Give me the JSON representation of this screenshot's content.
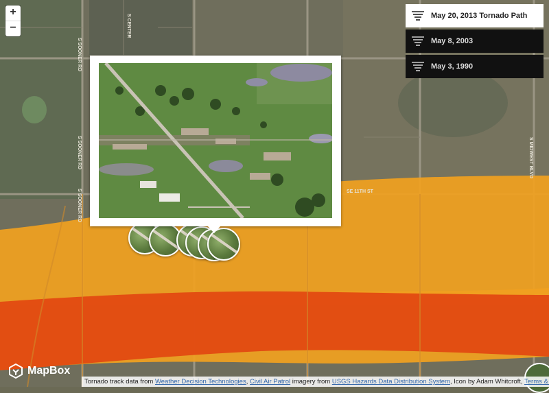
{
  "map": {
    "tornado_colors": {
      "outer": "#f0a020",
      "inner": "#e24a12"
    },
    "road_labels": [
      "S SOONER RD",
      "S SOONER RD",
      "S SOONER RD",
      "SE 11TH ST",
      "S MIDWEST BLVD",
      "S CENTER"
    ]
  },
  "zoom": {
    "in_label": "+",
    "out_label": "−"
  },
  "layers": [
    {
      "label": "May 20, 2013 Tornado Path",
      "active": true,
      "icon": "tornado-icon"
    },
    {
      "label": "May 8, 2003",
      "active": false,
      "icon": "tornado-icon"
    },
    {
      "label": "May 3, 1990",
      "active": false,
      "icon": "tornado-icon"
    }
  ],
  "logo": {
    "text": "MapBox",
    "icon": "mapbox-logo-icon"
  },
  "attribution": {
    "prefix": "Tornado track data from ",
    "link1": "Weather Decision Technologies",
    "sep1": ", ",
    "link2": "Civil Air Patrol",
    "mid": " imagery from ",
    "link3": "USGS Hazards Data Distribution System",
    "icon_text": ", Icon by Adam Whitcroft, ",
    "link4": "Terms & Feedback"
  }
}
